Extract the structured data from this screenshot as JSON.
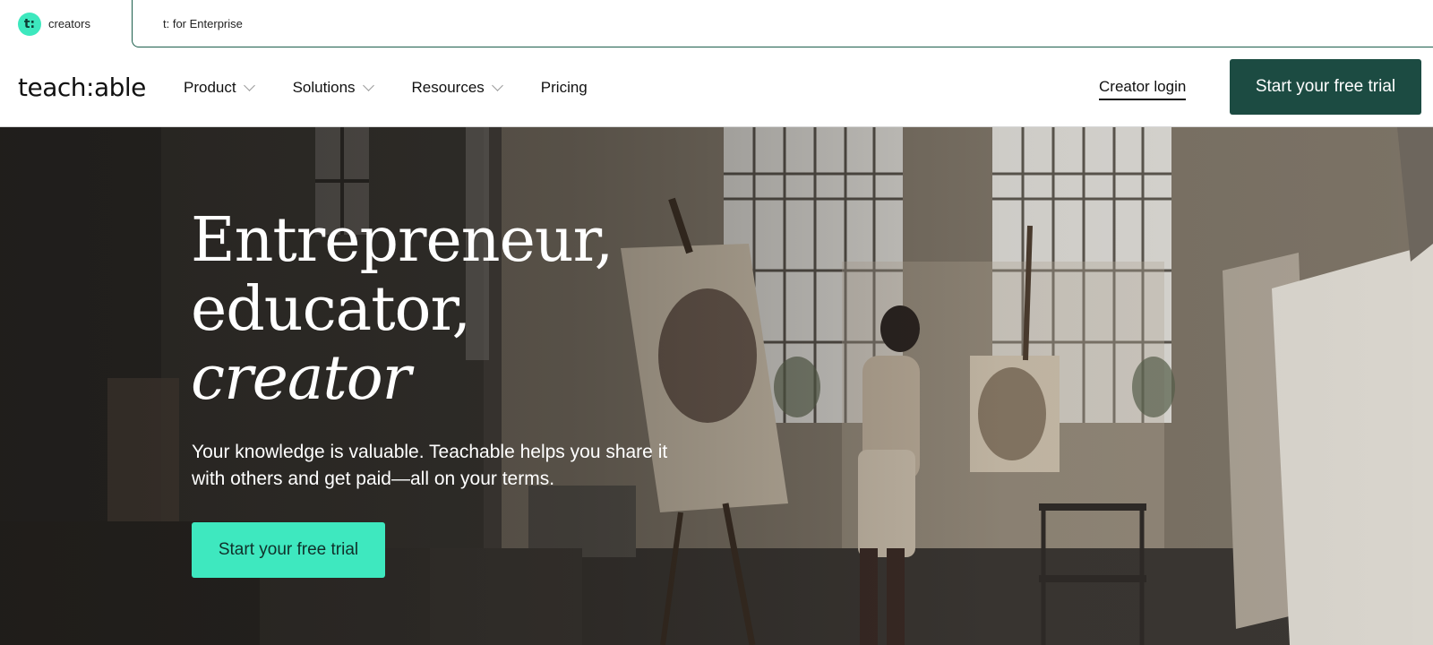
{
  "audience_switcher": {
    "creators_badge": "t:",
    "creators_label": "creators",
    "enterprise_label": "t: for Enterprise"
  },
  "nav": {
    "logo": "teach:able",
    "items": [
      {
        "label": "Product",
        "has_dropdown": true
      },
      {
        "label": "Solutions",
        "has_dropdown": true
      },
      {
        "label": "Resources",
        "has_dropdown": true
      },
      {
        "label": "Pricing",
        "has_dropdown": false
      }
    ],
    "login_label": "Creator login",
    "cta_label": "Start your free trial"
  },
  "hero": {
    "heading_line1": "Entrepreneur,",
    "heading_line2": "educator,",
    "heading_line3": "creator",
    "subtitle": "Your knowledge is valuable. Teachable helps you share it with others and get paid—all on your terms.",
    "cta_label": "Start your free trial"
  },
  "colors": {
    "accent_mint": "#3ee8bf",
    "brand_dark_green": "#1c4b42"
  }
}
